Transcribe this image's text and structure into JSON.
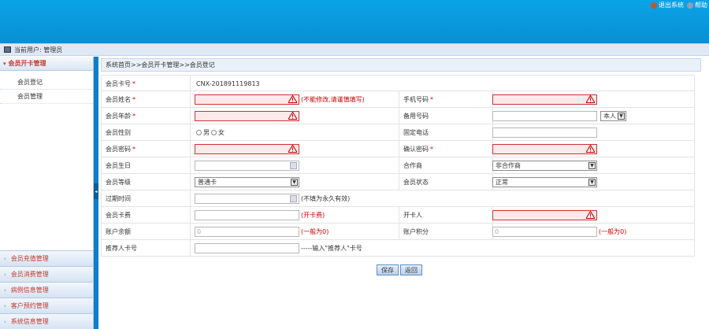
{
  "header": {
    "logout_label": "退出系统",
    "help_label": "帮助",
    "logout_icon_color": "#c0562a",
    "help_icon_color": "#8a9fb8",
    "bg_color": "#0a9ad9"
  },
  "userbar": {
    "current_user_label": "当前用户: 管理员"
  },
  "sidebar": {
    "active_group": "会员开卡管理",
    "active_items": [
      "会员登记",
      "会员管理"
    ],
    "groups": [
      "会员充值管理",
      "会员消费管理",
      "病例信息管理",
      "客户预约管理",
      "系统信息管理"
    ]
  },
  "breadcrumb": "系统首页>>会员开卡管理>>会员登记",
  "form": {
    "card_no_label": "会员卡号",
    "card_no_value": "CNX-201891119813",
    "name_label": "会员姓名",
    "name_hint": "(不能修改,请谨慎填写)",
    "phone_label": "手机号码",
    "age_label": "会员年龄",
    "backup_label": "备用号码",
    "backup_owner": "本人",
    "gender_label": "会员性别",
    "gender_male": "男",
    "gender_female": "女",
    "landline_label": "固定电话",
    "password_label": "会员密码",
    "confirm_label": "确认密码",
    "birthday_label": "会员生日",
    "partner_label": "合作商",
    "partner_value": "非合作商",
    "level_label": "会员等级",
    "level_value": "普通卡",
    "status_label": "会员状态",
    "status_value": "正常",
    "expire_label": "过期时间",
    "expire_hint": "(不填为永久有效)",
    "fee_label": "会员卡费",
    "fee_hint": "(开卡费)",
    "opener_label": "开卡人",
    "balance_label": "账户余额",
    "balance_value": "0",
    "balance_hint": "(一般为0)",
    "points_label": "账户积分",
    "points_value": "0",
    "points_hint": "(一般为0)",
    "referrer_label": "推荐人卡号",
    "referrer_hint": "-----输入\"推荐人\"卡号",
    "required_mark": "*"
  },
  "buttons": {
    "save": "保存",
    "back": "返回"
  }
}
